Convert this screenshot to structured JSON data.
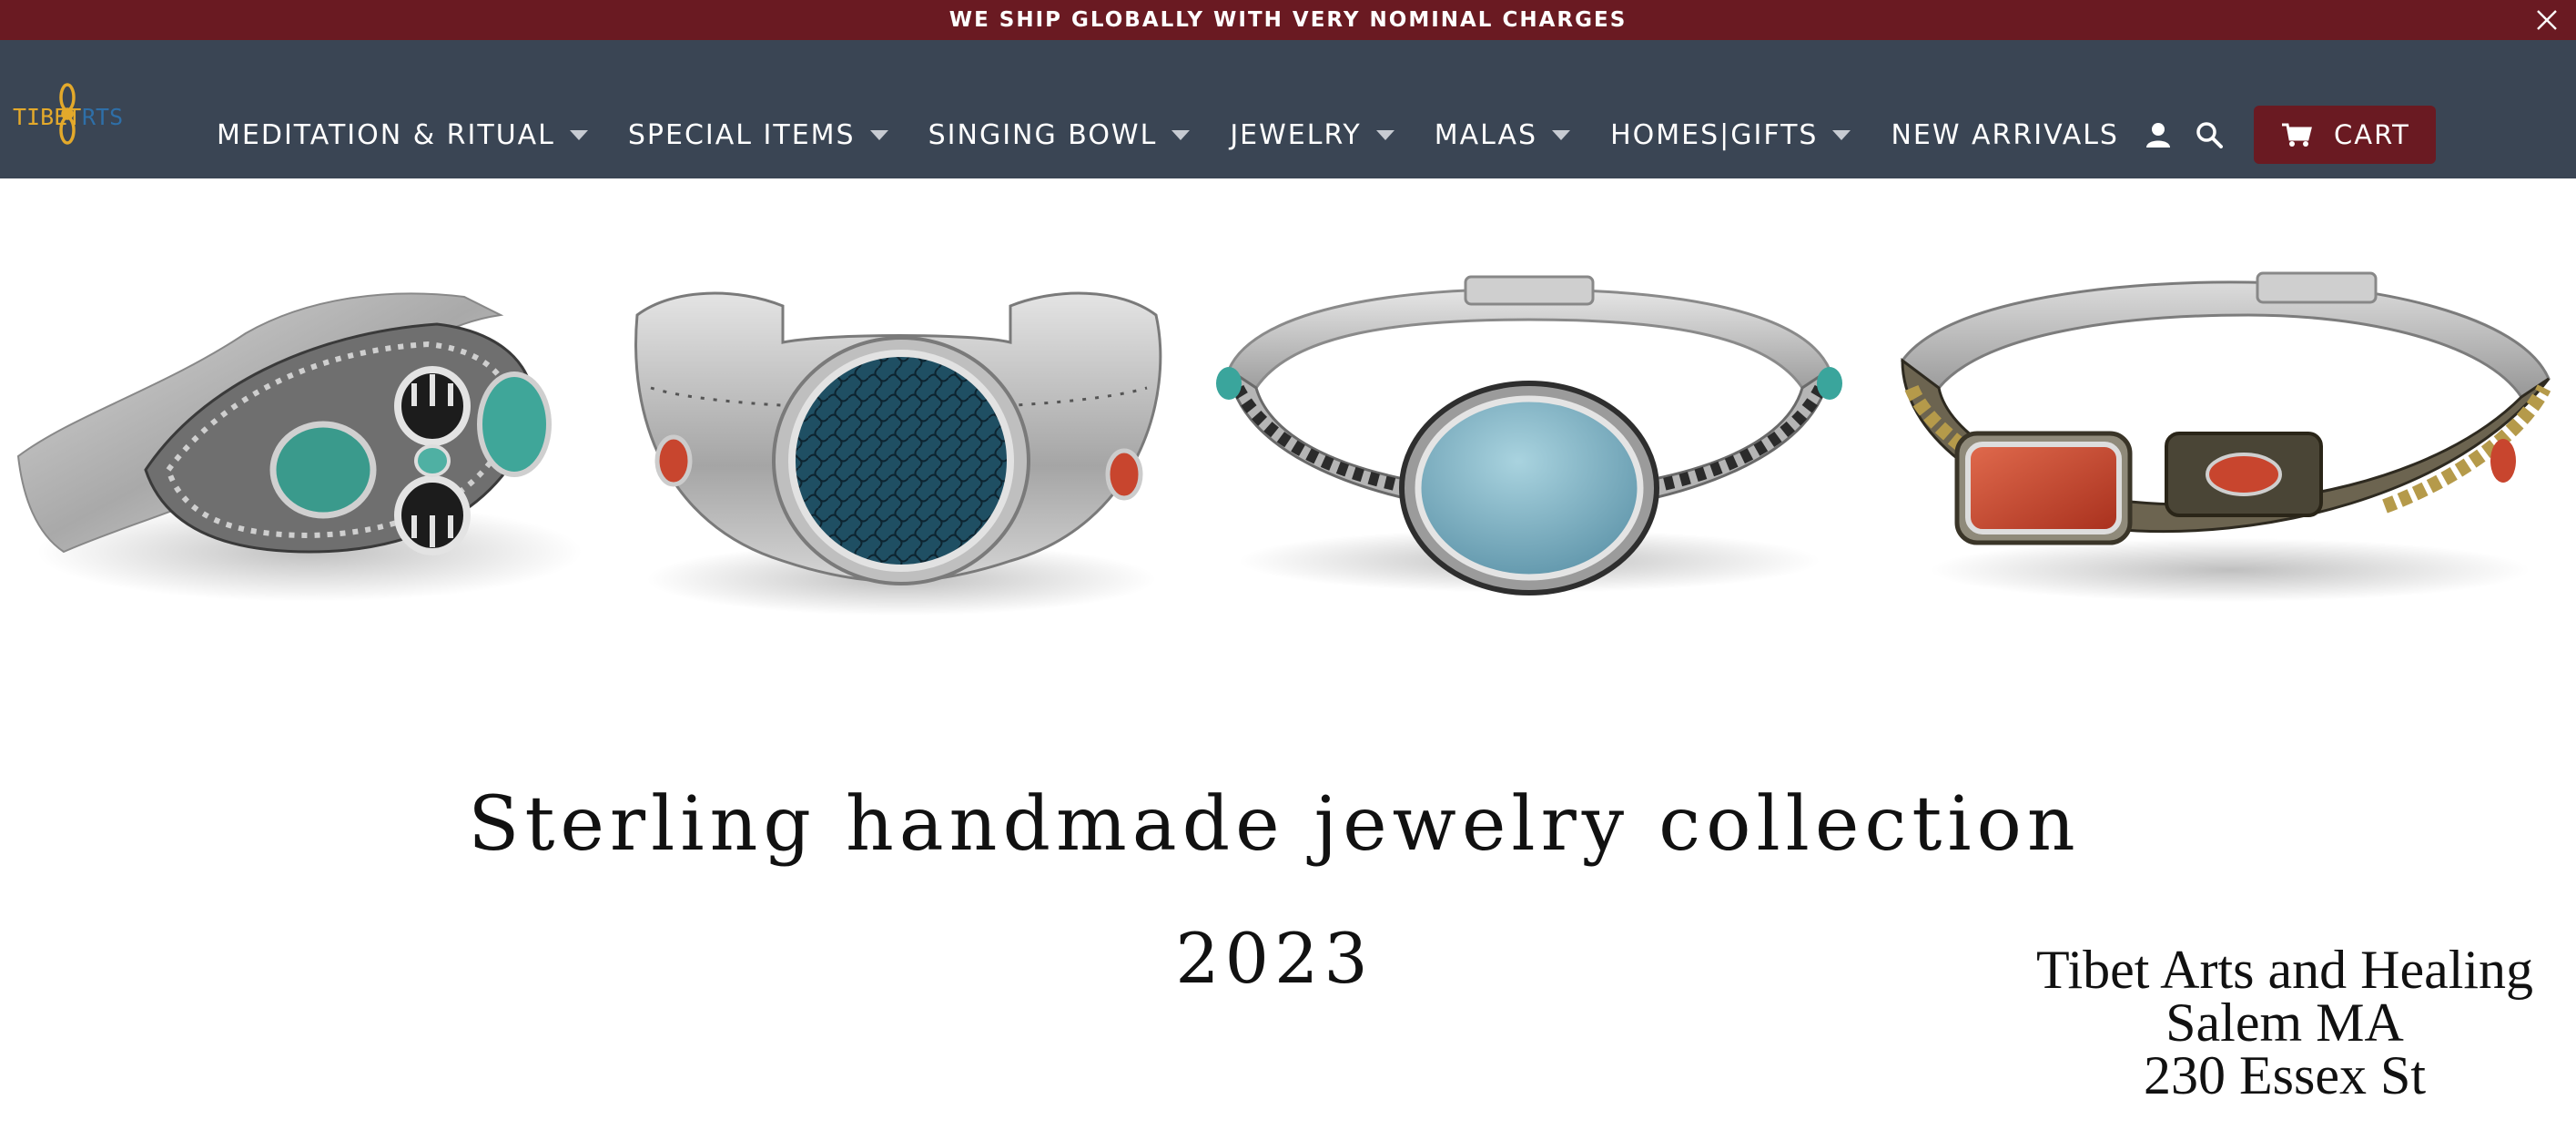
{
  "announcement": {
    "text": "WE SHIP GLOBALLY WITH VERY NOMINAL CHARGES",
    "close_icon": "close-icon"
  },
  "header": {
    "logo": {
      "text_left": "TIBET",
      "text_right": "RTS",
      "icon": "vajra-logo-icon"
    },
    "nav": [
      {
        "label": "MEDITATION & RITUAL",
        "has_dropdown": true
      },
      {
        "label": "SPECIAL ITEMS",
        "has_dropdown": true
      },
      {
        "label": "SINGING BOWL",
        "has_dropdown": true
      },
      {
        "label": "JEWELRY",
        "has_dropdown": true
      },
      {
        "label": "MALAS",
        "has_dropdown": true
      },
      {
        "label": "HOMES|GIFTS",
        "has_dropdown": true
      },
      {
        "label": "NEW ARRIVALS",
        "has_dropdown": false
      }
    ],
    "account_icon": "user-icon",
    "search_icon": "search-icon",
    "cart": {
      "label": "CART",
      "icon": "cart-icon"
    }
  },
  "banner": {
    "headline": "Sterling handmade jewelry collection",
    "year": "2023",
    "store": {
      "name": "Tibet Arts and Healing",
      "city": "Salem MA",
      "address": "230 Essex St"
    },
    "products": [
      {
        "name": "silver-cuff-turquoise-dorje",
        "stone_color": "#3a9a8c"
      },
      {
        "name": "silver-cuff-spiderweb-turquoise",
        "stone_color": "#1f4f63"
      },
      {
        "name": "silver-bangle-blue-chalcedony",
        "stone_color": "#7fb3c4"
      },
      {
        "name": "silver-bangle-red-coral",
        "stone_color": "#c8452e"
      }
    ]
  },
  "colors": {
    "announcement_bg": "#6a1a22",
    "header_bg": "#3a4554",
    "cart_bg": "#6a1a22",
    "logo_gold": "#e3a92b",
    "logo_blue": "#2e6fa8"
  }
}
